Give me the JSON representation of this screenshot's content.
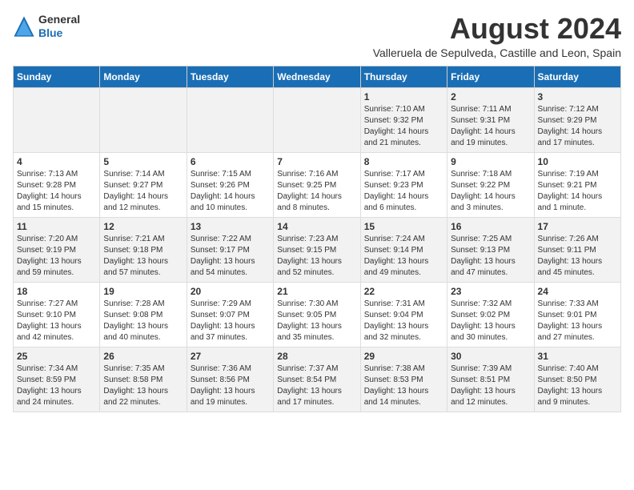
{
  "header": {
    "logo_general": "General",
    "logo_blue": "Blue",
    "month_year": "August 2024",
    "location": "Valleruela de Sepulveda, Castille and Leon, Spain"
  },
  "calendar": {
    "days_of_week": [
      "Sunday",
      "Monday",
      "Tuesday",
      "Wednesday",
      "Thursday",
      "Friday",
      "Saturday"
    ],
    "weeks": [
      [
        {
          "day": "",
          "info": ""
        },
        {
          "day": "",
          "info": ""
        },
        {
          "day": "",
          "info": ""
        },
        {
          "day": "",
          "info": ""
        },
        {
          "day": "1",
          "info": "Sunrise: 7:10 AM\nSunset: 9:32 PM\nDaylight: 14 hours\nand 21 minutes."
        },
        {
          "day": "2",
          "info": "Sunrise: 7:11 AM\nSunset: 9:31 PM\nDaylight: 14 hours\nand 19 minutes."
        },
        {
          "day": "3",
          "info": "Sunrise: 7:12 AM\nSunset: 9:29 PM\nDaylight: 14 hours\nand 17 minutes."
        }
      ],
      [
        {
          "day": "4",
          "info": "Sunrise: 7:13 AM\nSunset: 9:28 PM\nDaylight: 14 hours\nand 15 minutes."
        },
        {
          "day": "5",
          "info": "Sunrise: 7:14 AM\nSunset: 9:27 PM\nDaylight: 14 hours\nand 12 minutes."
        },
        {
          "day": "6",
          "info": "Sunrise: 7:15 AM\nSunset: 9:26 PM\nDaylight: 14 hours\nand 10 minutes."
        },
        {
          "day": "7",
          "info": "Sunrise: 7:16 AM\nSunset: 9:25 PM\nDaylight: 14 hours\nand 8 minutes."
        },
        {
          "day": "8",
          "info": "Sunrise: 7:17 AM\nSunset: 9:23 PM\nDaylight: 14 hours\nand 6 minutes."
        },
        {
          "day": "9",
          "info": "Sunrise: 7:18 AM\nSunset: 9:22 PM\nDaylight: 14 hours\nand 3 minutes."
        },
        {
          "day": "10",
          "info": "Sunrise: 7:19 AM\nSunset: 9:21 PM\nDaylight: 14 hours\nand 1 minute."
        }
      ],
      [
        {
          "day": "11",
          "info": "Sunrise: 7:20 AM\nSunset: 9:19 PM\nDaylight: 13 hours\nand 59 minutes."
        },
        {
          "day": "12",
          "info": "Sunrise: 7:21 AM\nSunset: 9:18 PM\nDaylight: 13 hours\nand 57 minutes."
        },
        {
          "day": "13",
          "info": "Sunrise: 7:22 AM\nSunset: 9:17 PM\nDaylight: 13 hours\nand 54 minutes."
        },
        {
          "day": "14",
          "info": "Sunrise: 7:23 AM\nSunset: 9:15 PM\nDaylight: 13 hours\nand 52 minutes."
        },
        {
          "day": "15",
          "info": "Sunrise: 7:24 AM\nSunset: 9:14 PM\nDaylight: 13 hours\nand 49 minutes."
        },
        {
          "day": "16",
          "info": "Sunrise: 7:25 AM\nSunset: 9:13 PM\nDaylight: 13 hours\nand 47 minutes."
        },
        {
          "day": "17",
          "info": "Sunrise: 7:26 AM\nSunset: 9:11 PM\nDaylight: 13 hours\nand 45 minutes."
        }
      ],
      [
        {
          "day": "18",
          "info": "Sunrise: 7:27 AM\nSunset: 9:10 PM\nDaylight: 13 hours\nand 42 minutes."
        },
        {
          "day": "19",
          "info": "Sunrise: 7:28 AM\nSunset: 9:08 PM\nDaylight: 13 hours\nand 40 minutes."
        },
        {
          "day": "20",
          "info": "Sunrise: 7:29 AM\nSunset: 9:07 PM\nDaylight: 13 hours\nand 37 minutes."
        },
        {
          "day": "21",
          "info": "Sunrise: 7:30 AM\nSunset: 9:05 PM\nDaylight: 13 hours\nand 35 minutes."
        },
        {
          "day": "22",
          "info": "Sunrise: 7:31 AM\nSunset: 9:04 PM\nDaylight: 13 hours\nand 32 minutes."
        },
        {
          "day": "23",
          "info": "Sunrise: 7:32 AM\nSunset: 9:02 PM\nDaylight: 13 hours\nand 30 minutes."
        },
        {
          "day": "24",
          "info": "Sunrise: 7:33 AM\nSunset: 9:01 PM\nDaylight: 13 hours\nand 27 minutes."
        }
      ],
      [
        {
          "day": "25",
          "info": "Sunrise: 7:34 AM\nSunset: 8:59 PM\nDaylight: 13 hours\nand 24 minutes."
        },
        {
          "day": "26",
          "info": "Sunrise: 7:35 AM\nSunset: 8:58 PM\nDaylight: 13 hours\nand 22 minutes."
        },
        {
          "day": "27",
          "info": "Sunrise: 7:36 AM\nSunset: 8:56 PM\nDaylight: 13 hours\nand 19 minutes."
        },
        {
          "day": "28",
          "info": "Sunrise: 7:37 AM\nSunset: 8:54 PM\nDaylight: 13 hours\nand 17 minutes."
        },
        {
          "day": "29",
          "info": "Sunrise: 7:38 AM\nSunset: 8:53 PM\nDaylight: 13 hours\nand 14 minutes."
        },
        {
          "day": "30",
          "info": "Sunrise: 7:39 AM\nSunset: 8:51 PM\nDaylight: 13 hours\nand 12 minutes."
        },
        {
          "day": "31",
          "info": "Sunrise: 7:40 AM\nSunset: 8:50 PM\nDaylight: 13 hours\nand 9 minutes."
        }
      ]
    ]
  }
}
